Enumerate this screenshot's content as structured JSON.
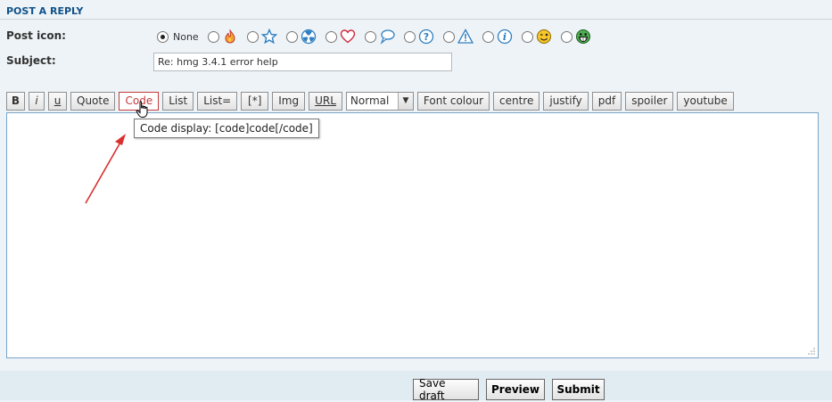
{
  "panel": {
    "title": "POST A REPLY"
  },
  "post_icon": {
    "label": "Post icon:",
    "none_label": "None",
    "selected": "None",
    "icons": [
      "fire-icon",
      "star-icon",
      "radioactive-icon",
      "heart-icon",
      "speech-bubble-icon",
      "question-icon",
      "warning-icon",
      "info-icon",
      "wink-smiley-icon",
      "grin-smiley-icon"
    ]
  },
  "subject": {
    "label": "Subject:",
    "value": "Re: hmg 3.4.1 error help"
  },
  "toolbar": {
    "bold": "B",
    "italic": "i",
    "underline": "u",
    "quote": "Quote",
    "code": "Code",
    "list": "List",
    "list_eq": "List=",
    "list_item": "[*]",
    "img": "Img",
    "url": "URL",
    "font_size": "Normal",
    "font_colour": "Font colour",
    "centre": "centre",
    "justify": "justify",
    "pdf": "pdf",
    "spoiler": "spoiler",
    "youtube": "youtube"
  },
  "tooltip": {
    "text": "Code display: [code]code[/code]"
  },
  "editor": {
    "value": ""
  },
  "footer": {
    "save_draft": "Save draft",
    "preview": "Preview",
    "submit": "Submit"
  },
  "colors": {
    "title": "#105289",
    "code_hover": "#c43b3b",
    "annotation_arrow": "#d93030",
    "editor_border": "#7aa5c8"
  }
}
